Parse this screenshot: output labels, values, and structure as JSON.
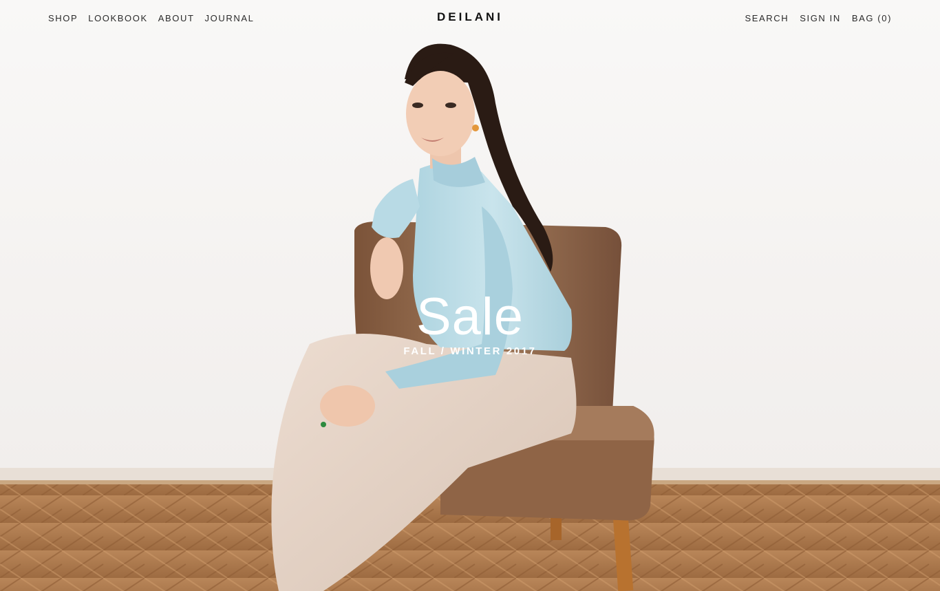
{
  "brand": {
    "logo": "DEILANI"
  },
  "nav": {
    "left": [
      {
        "label": "SHOP"
      },
      {
        "label": "LOOKBOOK"
      },
      {
        "label": "ABOUT"
      },
      {
        "label": "JOURNAL"
      }
    ],
    "right": [
      {
        "label": "SEARCH"
      },
      {
        "label": "SIGN IN"
      },
      {
        "label": "BAG (0)"
      }
    ]
  },
  "hero": {
    "title": "Sale",
    "subtitle": "FALL / WINTER 2017",
    "colors": {
      "wall": "#f7f5f4",
      "floor": "#b27b4c",
      "chair": "#8e6549",
      "blouse": "#bcdbe5",
      "skirt": "#e3d2c5",
      "hair": "#2a1b14"
    }
  }
}
